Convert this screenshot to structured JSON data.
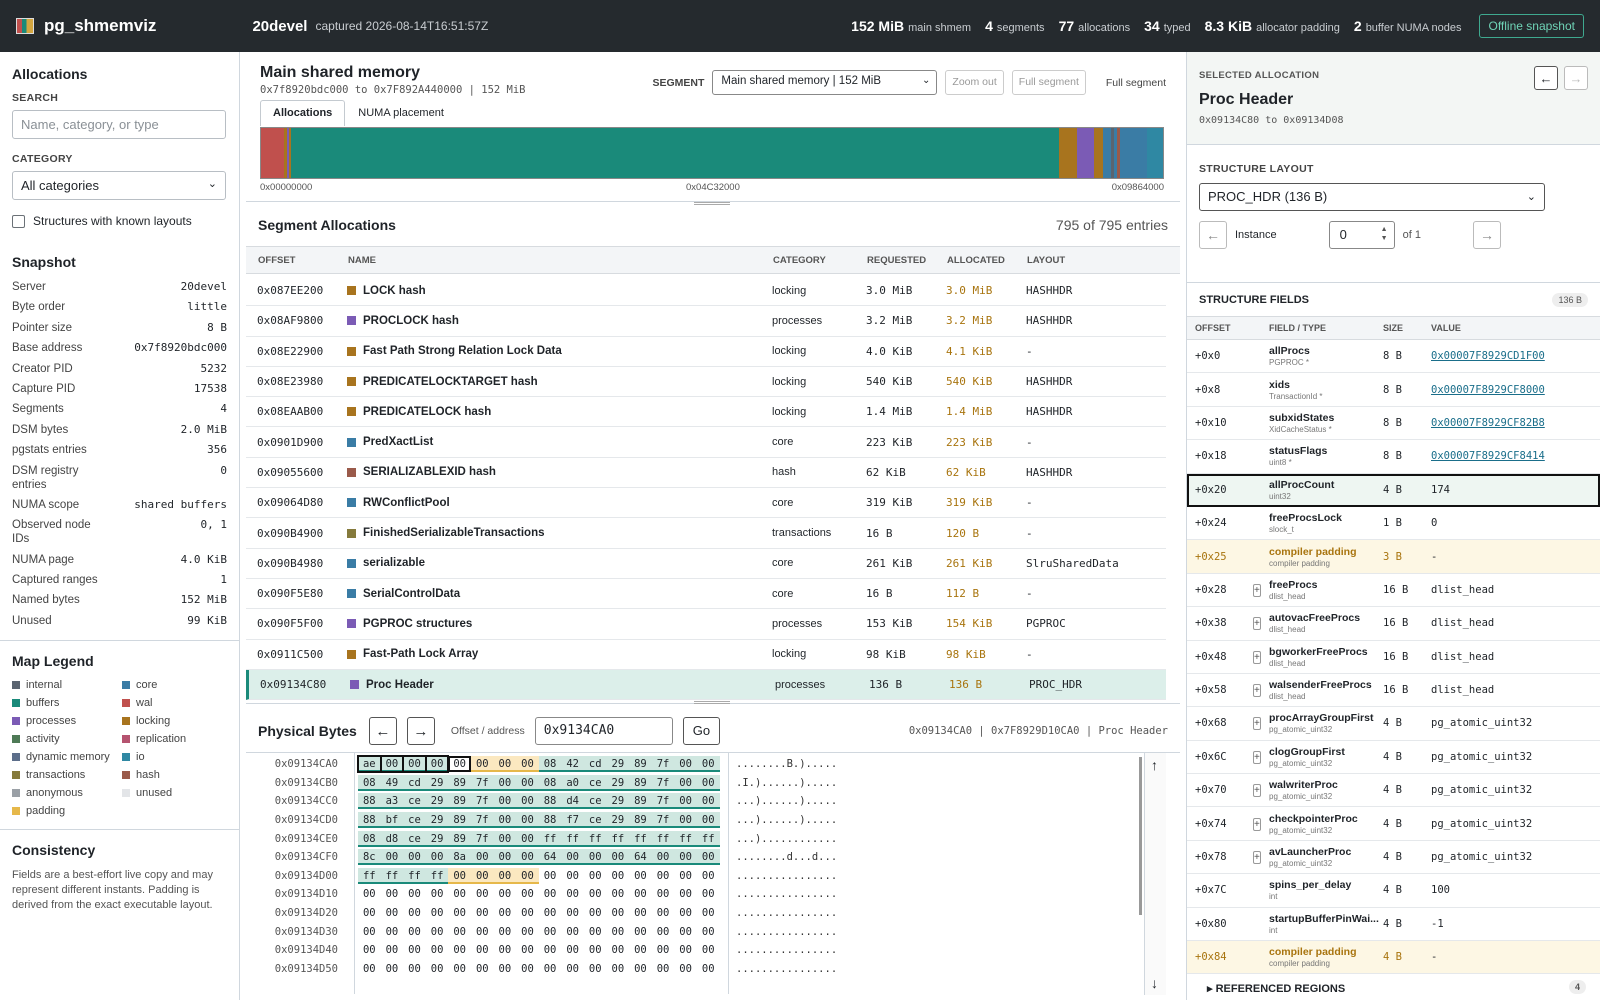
{
  "topbar": {
    "app_title": "pg_shmemviz",
    "server": "20devel",
    "captured": "captured 2026-08-14T16:51:57Z",
    "stats": [
      {
        "value": "152 MiB",
        "label": "main shmem"
      },
      {
        "value": "4",
        "label": "segments"
      },
      {
        "value": "77",
        "label": "allocations"
      },
      {
        "value": "34",
        "label": "typed"
      },
      {
        "value": "8.3 KiB",
        "label": "allocator padding"
      },
      {
        "value": "2",
        "label": "buffer NUMA nodes"
      }
    ],
    "offline_label": "Offline snapshot"
  },
  "left": {
    "allocations_title": "Allocations",
    "search_label": "SEARCH",
    "search_placeholder": "Name, category, or type",
    "category_label": "CATEGORY",
    "category_value": "All categories",
    "known_layouts_label": "Structures with known layouts",
    "snapshot_title": "Snapshot",
    "snapshot": [
      {
        "k": "Server",
        "v": "20devel"
      },
      {
        "k": "Byte order",
        "v": "little"
      },
      {
        "k": "Pointer size",
        "v": "8 B"
      },
      {
        "k": "Base address",
        "v": "0x7f8920bdc000"
      },
      {
        "k": "Creator PID",
        "v": "5232"
      },
      {
        "k": "Capture PID",
        "v": "17538"
      },
      {
        "k": "Segments",
        "v": "4"
      },
      {
        "k": "DSM bytes",
        "v": "2.0 MiB"
      },
      {
        "k": "pgstats entries",
        "v": "356"
      },
      {
        "k": "DSM registry entries",
        "v": "0"
      },
      {
        "k": "NUMA scope",
        "v": "shared buffers"
      },
      {
        "k": "Observed node IDs",
        "v": "0, 1"
      },
      {
        "k": "NUMA page",
        "v": "4.0 KiB"
      },
      {
        "k": "Captured ranges",
        "v": "1"
      },
      {
        "k": "Named bytes",
        "v": "152 MiB"
      },
      {
        "k": "Unused",
        "v": "99 KiB"
      }
    ],
    "legend_title": "Map Legend",
    "legend": [
      {
        "name": "internal",
        "color": "#5a6470"
      },
      {
        "name": "core",
        "color": "#3a7ca5"
      },
      {
        "name": "buffers",
        "color": "#1a8a7a"
      },
      {
        "name": "wal",
        "color": "#c0504d"
      },
      {
        "name": "processes",
        "color": "#7b5bb5"
      },
      {
        "name": "locking",
        "color": "#a8741e"
      },
      {
        "name": "activity",
        "color": "#4e7a56"
      },
      {
        "name": "replication",
        "color": "#b5536f"
      },
      {
        "name": "dynamic memory",
        "color": "#5c6e8a"
      },
      {
        "name": "io",
        "color": "#2f88a3"
      },
      {
        "name": "transactions",
        "color": "#857a3c"
      },
      {
        "name": "hash",
        "color": "#9a5a4a"
      },
      {
        "name": "anonymous",
        "color": "#9aa0a6"
      },
      {
        "name": "unused",
        "color": "#e3e5e8"
      },
      {
        "name": "padding",
        "color": "#e6b84a"
      }
    ],
    "consistency_title": "Consistency",
    "consistency_text": "Fields are a best-effort live copy and may represent different instants. Padding is derived from the exact executable layout."
  },
  "main": {
    "title": "Main shared memory",
    "range": "0x7f8920bdc000 to 0x7F892A440000 | 152 MiB",
    "segment_label": "SEGMENT",
    "segment_value": "Main shared memory | 152 MiB",
    "zoom_out": "Zoom out",
    "full_segment_btn": "Full segment",
    "full_segment_text": "Full segment",
    "tabs": [
      "Allocations",
      "NUMA placement"
    ],
    "map_axis": [
      "0x00000000",
      "0x04C32000",
      "0x09864000"
    ],
    "map_blocks": [
      {
        "color": "#c0504d",
        "w": 2.6
      },
      {
        "color": "#a8741e",
        "w": 0.3
      },
      {
        "color": "#7b5bb5",
        "w": 0.2
      },
      {
        "color": "#a8741e",
        "w": 0.2
      },
      {
        "color": "#1a8a7a",
        "w": 85.2
      },
      {
        "color": "#a8741e",
        "w": 2.0
      },
      {
        "color": "#7b5bb5",
        "w": 1.9
      },
      {
        "color": "#a8741e",
        "w": 1.0
      },
      {
        "color": "#3a7ca5",
        "w": 0.8
      },
      {
        "color": "#5a6470",
        "w": 0.4
      },
      {
        "color": "#3a7ca5",
        "w": 0.3
      },
      {
        "color": "#9a5a4a",
        "w": 0.3
      },
      {
        "color": "#3a7ca5",
        "w": 3.0
      },
      {
        "color": "#2f88a3",
        "w": 1.8
      }
    ]
  },
  "alloc": {
    "title": "Segment Allocations",
    "count": "795 of 795 entries",
    "columns": [
      "OFFSET",
      "NAME",
      "CATEGORY",
      "REQUESTED",
      "ALLOCATED",
      "LAYOUT"
    ],
    "rows": [
      {
        "offset": "0x087EE200",
        "name": "LOCK hash",
        "category": "locking",
        "requested": "3.0 MiB",
        "allocated": "3.0 MiB",
        "layout": "HASHHDR",
        "color": "#a8741e"
      },
      {
        "offset": "0x08AF9800",
        "name": "PROCLOCK hash",
        "category": "processes",
        "requested": "3.2 MiB",
        "allocated": "3.2 MiB",
        "layout": "HASHHDR",
        "color": "#7b5bb5"
      },
      {
        "offset": "0x08E22900",
        "name": "Fast Path Strong Relation Lock Data",
        "category": "locking",
        "requested": "4.0 KiB",
        "allocated": "4.1 KiB",
        "layout": "-",
        "color": "#a8741e"
      },
      {
        "offset": "0x08E23980",
        "name": "PREDICATELOCKTARGET hash",
        "category": "locking",
        "requested": "540 KiB",
        "allocated": "540 KiB",
        "layout": "HASHHDR",
        "color": "#a8741e"
      },
      {
        "offset": "0x08EAAB00",
        "name": "PREDICATELOCK hash",
        "category": "locking",
        "requested": "1.4 MiB",
        "allocated": "1.4 MiB",
        "layout": "HASHHDR",
        "color": "#a8741e"
      },
      {
        "offset": "0x0901D900",
        "name": "PredXactList",
        "category": "core",
        "requested": "223 KiB",
        "allocated": "223 KiB",
        "layout": "-",
        "color": "#3a7ca5"
      },
      {
        "offset": "0x09055600",
        "name": "SERIALIZABLEXID hash",
        "category": "hash",
        "requested": "62 KiB",
        "allocated": "62 KiB",
        "layout": "HASHHDR",
        "color": "#9a5a4a"
      },
      {
        "offset": "0x09064D80",
        "name": "RWConflictPool",
        "category": "core",
        "requested": "319 KiB",
        "allocated": "319 KiB",
        "layout": "-",
        "color": "#3a7ca5"
      },
      {
        "offset": "0x090B4900",
        "name": "FinishedSerializableTransactions",
        "category": "transactions",
        "requested": "16 B",
        "allocated": "120 B",
        "layout": "-",
        "color": "#857a3c"
      },
      {
        "offset": "0x090B4980",
        "name": "serializable",
        "category": "core",
        "requested": "261 KiB",
        "allocated": "261 KiB",
        "layout": "SlruSharedData",
        "color": "#3a7ca5"
      },
      {
        "offset": "0x090F5E80",
        "name": "SerialControlData",
        "category": "core",
        "requested": "16 B",
        "allocated": "112 B",
        "layout": "-",
        "color": "#3a7ca5"
      },
      {
        "offset": "0x090F5F00",
        "name": "PGPROC structures",
        "category": "processes",
        "requested": "153 KiB",
        "allocated": "154 KiB",
        "layout": "PGPROC",
        "color": "#7b5bb5"
      },
      {
        "offset": "0x0911C500",
        "name": "Fast-Path Lock Array",
        "category": "locking",
        "requested": "98 KiB",
        "allocated": "98 KiB",
        "layout": "-",
        "color": "#a8741e"
      },
      {
        "offset": "0x09134C80",
        "name": "Proc Header",
        "category": "processes",
        "requested": "136 B",
        "allocated": "136 B",
        "layout": "PROC_HDR",
        "color": "#7b5bb5",
        "selected": true
      }
    ]
  },
  "hex": {
    "title": "Physical Bytes",
    "addr_label": "Offset / address",
    "addr_value": "0x9134CA0",
    "go_label": "Go",
    "info": "0x09134CA0 | 0x7F8929D10CA0 | Proc Header",
    "rows": [
      {
        "addr": "0x09134CA0",
        "bytes": "ae 00 00 00 00 00 00 00 08 42 cd 29 89 7f 00 00",
        "ascii": "........B.).....",
        "kinds": "ppppCyyyppppppppx"
      },
      {
        "addr": "0x09134CB0",
        "bytes": "08 49 cd 29 89 7f 00 00 08 a0 ce 29 89 7f 00 00",
        "ascii": ".I.)......).....",
        "kinds": "pppppppppppppppp"
      },
      {
        "addr": "0x09134CC0",
        "bytes": "88 a3 ce 29 89 7f 00 00 88 d4 ce 29 89 7f 00 00",
        "ascii": "...)......).....",
        "kinds": "pppppppppppppppp"
      },
      {
        "addr": "0x09134CD0",
        "bytes": "88 bf ce 29 89 7f 00 00 88 f7 ce 29 89 7f 00 00",
        "ascii": "...)......).....",
        "kinds": "pppppppppppppppp"
      },
      {
        "addr": "0x09134CE0",
        "bytes": "08 d8 ce 29 89 7f 00 00 ff ff ff ff ff ff ff ff",
        "ascii": "...)............",
        "kinds": "pppppppppppppppp"
      },
      {
        "addr": "0x09134CF0",
        "bytes": "8c 00 00 00 8a 00 00 00 64 00 00 00 64 00 00 00",
        "ascii": "........d...d...",
        "kinds": "pppppppppppppppp"
      },
      {
        "addr": "0x09134D00",
        "bytes": "ff ff ff ff 00 00 00 00 00 00 00 00 00 00 00 00",
        "ascii": "................",
        "kinds": "ppppyyyy--------"
      },
      {
        "addr": "0x09134D10",
        "bytes": "00 00 00 00 00 00 00 00 00 00 00 00 00 00 00 00",
        "ascii": "................",
        "kinds": "----------------"
      },
      {
        "addr": "0x09134D20",
        "bytes": "00 00 00 00 00 00 00 00 00 00 00 00 00 00 00 00",
        "ascii": "................",
        "kinds": "----------------"
      },
      {
        "addr": "0x09134D30",
        "bytes": "00 00 00 00 00 00 00 00 00 00 00 00 00 00 00 00",
        "ascii": "................",
        "kinds": "----------------"
      },
      {
        "addr": "0x09134D40",
        "bytes": "00 00 00 00 00 00 00 00 00 00 00 00 00 00 00 00",
        "ascii": "................",
        "kinds": "----------------"
      },
      {
        "addr": "0x09134D50",
        "bytes": "00 00 00 00 00 00 00 00 00 00 00 00 00 00 00 00",
        "ascii": "................",
        "kinds": "----------------"
      }
    ]
  },
  "right": {
    "selected_label": "SELECTED ALLOCATION",
    "selected_name": "Proc Header",
    "selected_range": "0x09134C80 to 0x09134D08",
    "layout_label": "STRUCTURE LAYOUT",
    "layout_value": "PROC_HDR (136 B)",
    "instance_label": "Instance",
    "instance_value": "0",
    "instance_of": "of 1",
    "fields_title": "STRUCTURE FIELDS",
    "fields_size": "136 B",
    "field_columns": [
      "OFFSET",
      "FIELD / TYPE",
      "SIZE",
      "VALUE"
    ],
    "fields": [
      {
        "off": "+0x0",
        "name": "allProcs",
        "type": "PGPROC *",
        "size": "8 B",
        "value": "0x00007F8929CD1F00",
        "link": true
      },
      {
        "off": "+0x8",
        "name": "xids",
        "type": "TransactionId *",
        "size": "8 B",
        "value": "0x00007F8929CF8000",
        "link": true
      },
      {
        "off": "+0x10",
        "name": "subxidStates",
        "type": "XidCacheStatus *",
        "size": "8 B",
        "value": "0x00007F8929CF82B8",
        "link": true
      },
      {
        "off": "+0x18",
        "name": "statusFlags",
        "type": "uint8 *",
        "size": "8 B",
        "value": "0x00007F8929CF8414",
        "link": true
      },
      {
        "off": "+0x20",
        "name": "allProcCount",
        "type": "uint32",
        "size": "4 B",
        "value": "174",
        "highlight": true
      },
      {
        "off": "+0x24",
        "name": "freeProcsLock",
        "type": "slock_t",
        "size": "1 B",
        "value": "0"
      },
      {
        "off": "+0x25",
        "name": "compiler padding",
        "type": "compiler padding",
        "size": "3 B",
        "value": "-",
        "pad": true
      },
      {
        "off": "+0x28",
        "name": "freeProcs",
        "type": "dlist_head",
        "size": "16 B",
        "value": "dlist_head",
        "expand": true
      },
      {
        "off": "+0x38",
        "name": "autovacFreeProcs",
        "type": "dlist_head",
        "size": "16 B",
        "value": "dlist_head",
        "expand": true
      },
      {
        "off": "+0x48",
        "name": "bgworkerFreeProcs",
        "type": "dlist_head",
        "size": "16 B",
        "value": "dlist_head",
        "expand": true
      },
      {
        "off": "+0x58",
        "name": "walsenderFreeProcs",
        "type": "dlist_head",
        "size": "16 B",
        "value": "dlist_head",
        "expand": true
      },
      {
        "off": "+0x68",
        "name": "procArrayGroupFirst",
        "type": "pg_atomic_uint32",
        "size": "4 B",
        "value": "pg_atomic_uint32",
        "expand": true
      },
      {
        "off": "+0x6C",
        "name": "clogGroupFirst",
        "type": "pg_atomic_uint32",
        "size": "4 B",
        "value": "pg_atomic_uint32",
        "expand": true
      },
      {
        "off": "+0x70",
        "name": "walwriterProc",
        "type": "pg_atomic_uint32",
        "size": "4 B",
        "value": "pg_atomic_uint32",
        "expand": true
      },
      {
        "off": "+0x74",
        "name": "checkpointerProc",
        "type": "pg_atomic_uint32",
        "size": "4 B",
        "value": "pg_atomic_uint32",
        "expand": true
      },
      {
        "off": "+0x78",
        "name": "avLauncherProc",
        "type": "pg_atomic_uint32",
        "size": "4 B",
        "value": "pg_atomic_uint32",
        "expand": true
      },
      {
        "off": "+0x7C",
        "name": "spins_per_delay",
        "type": "int",
        "size": "4 B",
        "value": "100"
      },
      {
        "off": "+0x80",
        "name": "startupBufferPinWai...",
        "type": "int",
        "size": "4 B",
        "value": "-1"
      },
      {
        "off": "+0x84",
        "name": "compiler padding",
        "type": "compiler padding",
        "size": "4 B",
        "value": "-",
        "pad": true
      }
    ],
    "refs_title": "REFERENCED REGIONS",
    "refs_count": "4"
  }
}
